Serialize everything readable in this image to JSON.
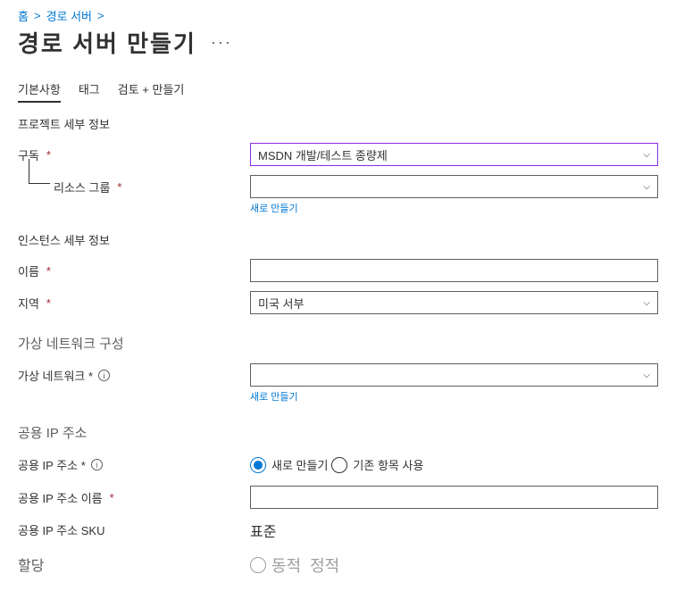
{
  "breadcrumb": {
    "home": "홈",
    "item1": "경로 서버"
  },
  "page_title": "경로 서버 만들기",
  "tabs": {
    "basic": "기본사항",
    "tags": "태그",
    "review": "검토 + 만들기"
  },
  "sections": {
    "project_details": "프로젝트 세부 정보",
    "instance_details": "인스턴스 세부 정보",
    "vnet_config": "가상 네트워크 구성",
    "public_ip": "공용 IP 주소"
  },
  "labels": {
    "subscription": "구독",
    "resource_group": "리소스 그룹",
    "name": "이름",
    "region": "지역",
    "vnet": "가상 네트워크 *",
    "public_ip": "공용 IP 주소 *",
    "public_ip_name": "공용 IP 주소 이름",
    "public_ip_sku": "공용 IP 주소 SKU",
    "assignment": "할당"
  },
  "values": {
    "subscription": "MSDN 개발/테스트 종량제",
    "resource_group": "",
    "name": "",
    "region": "미국 서부",
    "vnet": "",
    "public_ip_name": "",
    "public_ip_sku": "표준"
  },
  "links": {
    "create_new": "새로 만들기"
  },
  "radio": {
    "create_new": "새로 만들기",
    "use_existing": "기존 항목 사용",
    "dynamic": "동적",
    "static": "정적"
  }
}
